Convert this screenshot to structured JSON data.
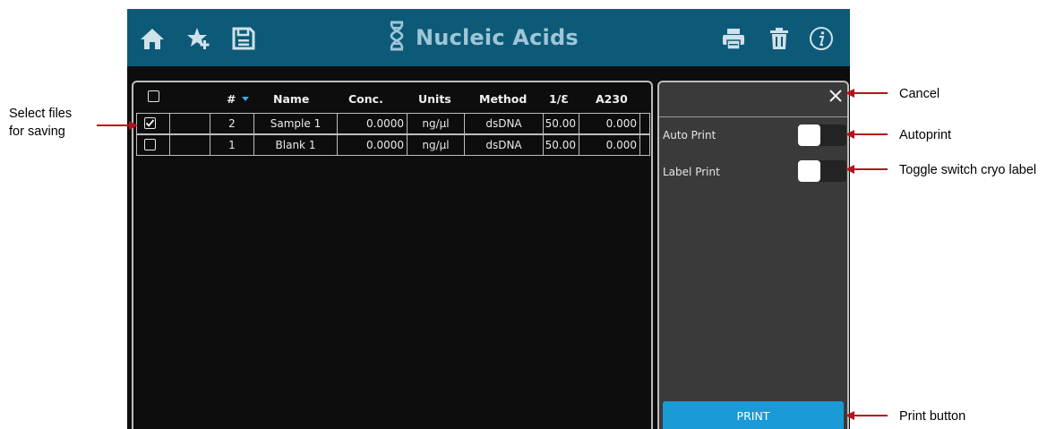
{
  "app": {
    "title": "Nucleic Acids",
    "icons": [
      "home-icon",
      "favorites-star-icon",
      "save-disk-icon",
      "dna-icon",
      "print-icon",
      "trash-icon",
      "info-icon"
    ],
    "colors": {
      "header": "#0d5a78",
      "title": "#9fc6d6",
      "print_button": "#1a9ad6",
      "sort_arrow": "#4aa3df"
    }
  },
  "table": {
    "headers": {
      "num": "#",
      "name": "Name",
      "conc": "Conc.",
      "units": "Units",
      "method": "Method",
      "inv_e": "1/Ɛ",
      "a230": "A230"
    },
    "select_all_checked": false,
    "rows": [
      {
        "checked": true,
        "num": "2",
        "name": "Sample 1",
        "conc": "0.0000",
        "units": "ng/µl",
        "method": "dsDNA",
        "inv_e": "50.00",
        "a230": "0.000"
      },
      {
        "checked": false,
        "num": "1",
        "name": "Blank 1",
        "conc": "0.0000",
        "units": "ng/µl",
        "method": "dsDNA",
        "inv_e": "50.00",
        "a230": "0.000"
      }
    ]
  },
  "print_panel": {
    "auto_print_label": "Auto Print",
    "auto_print_on": false,
    "label_print_label": "Label Print",
    "label_print_on": false,
    "print_button": "PRINT"
  },
  "annotations": {
    "select_files_line1": "Select files",
    "select_files_line2": "for saving",
    "cancel": "Cancel",
    "autoprint": "Autoprint",
    "toggle": "Toggle switch cryo label",
    "print_button": "Print button"
  }
}
